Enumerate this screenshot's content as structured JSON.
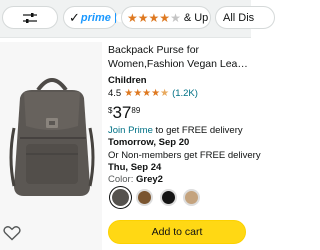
{
  "filters": {
    "prime_label": "prime",
    "rating_label": "& Up",
    "all_label": "All Dis"
  },
  "product": {
    "title_line1": "Backpack Purse for",
    "title_line2": "Women,Fashion Vegan Leath...",
    "brand": "Children",
    "rating": "4.5",
    "rating_count": "(1.2K)",
    "price_symbol": "$",
    "price_whole": "37",
    "price_fraction": "89",
    "prime_link": "Join Prime",
    "prime_delivery": " to get FREE delivery",
    "prime_date": "Tomorrow, Sep 20",
    "nonmember_delivery": "Or Non-members get FREE delivery",
    "nonmember_date": "Thu, Sep 24",
    "color_label": "Color: ",
    "color_value": "Grey2",
    "add_to_cart": "Add to cart",
    "rating_fraction": 0.9
  },
  "colors": {
    "prime_blue": "#1a98ff",
    "star_orange": "#de7921",
    "link_teal": "#007185",
    "cart_yellow": "#ffd814"
  }
}
